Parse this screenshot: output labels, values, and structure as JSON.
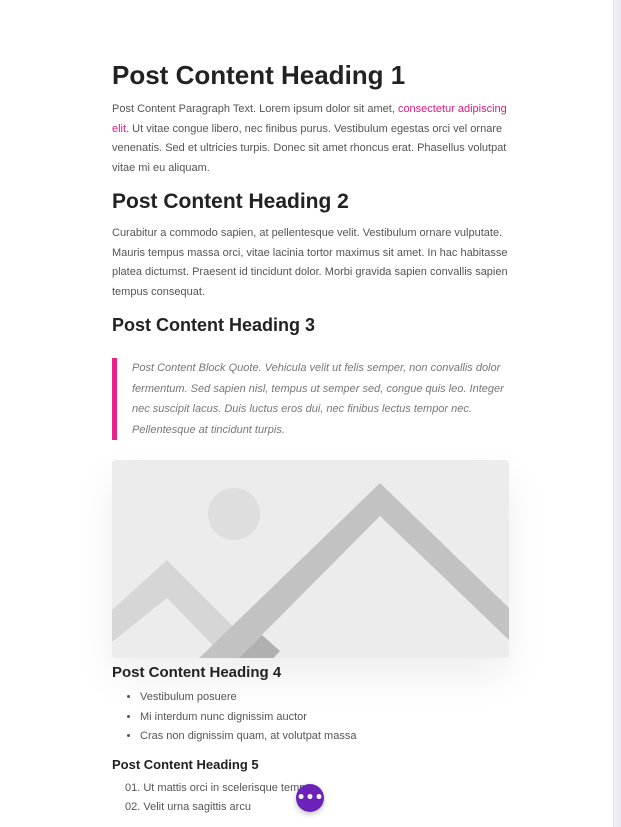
{
  "post": {
    "heading1": "Post Content Heading 1",
    "paragraph1": {
      "before_link": "Post Content Paragraph Text. Lorem ipsum dolor sit amet, ",
      "link_text": "consectetur adipiscing elit",
      "after_link": ". Ut vitae congue libero, nec finibus purus. Vestibulum egestas orci vel ornare venenatis. Sed et ultricies turpis. Donec sit amet rhoncus erat. Phasellus volutpat vitae mi eu aliquam."
    },
    "heading2": "Post Content Heading 2",
    "paragraph2": "Curabitur a commodo sapien, at pellentesque velit. Vestibulum ornare vulputate. Mauris tempus massa orci, vitae lacinia tortor maximus sit amet. In hac habitasse platea dictumst. Praesent id tincidunt dolor. Morbi gravida sapien convallis sapien tempus consequat.",
    "heading3": "Post Content Heading 3",
    "blockquote": "Post Content Block Quote. Vehicula velit ut felis semper, non convallis dolor fermentum. Sed sapien nisl, tempus ut semper sed, congue quis leo. Integer nec suscipit lacus. Duis luctus eros dui, nec finibus lectus tempor nec. Pellentesque at tincidunt turpis.",
    "heading4": "Post Content Heading 4",
    "bullet_list": [
      "Vestibulum posuere",
      "Mi interdum nunc dignissim auctor",
      "Cras non dignissim quam, at volutpat massa"
    ],
    "heading5": "Post Content Heading 5",
    "numbered_list": [
      "01. Ut mattis orci in scelerisque tempor",
      "02. Velit urna sagittis arcu"
    ]
  },
  "fab": {
    "label": "•••",
    "icon": "more-icon",
    "color": "#6c22b8"
  },
  "colors": {
    "accent": "#e8228a",
    "heading": "#222222",
    "body": "#555555",
    "quote": "#777777"
  }
}
